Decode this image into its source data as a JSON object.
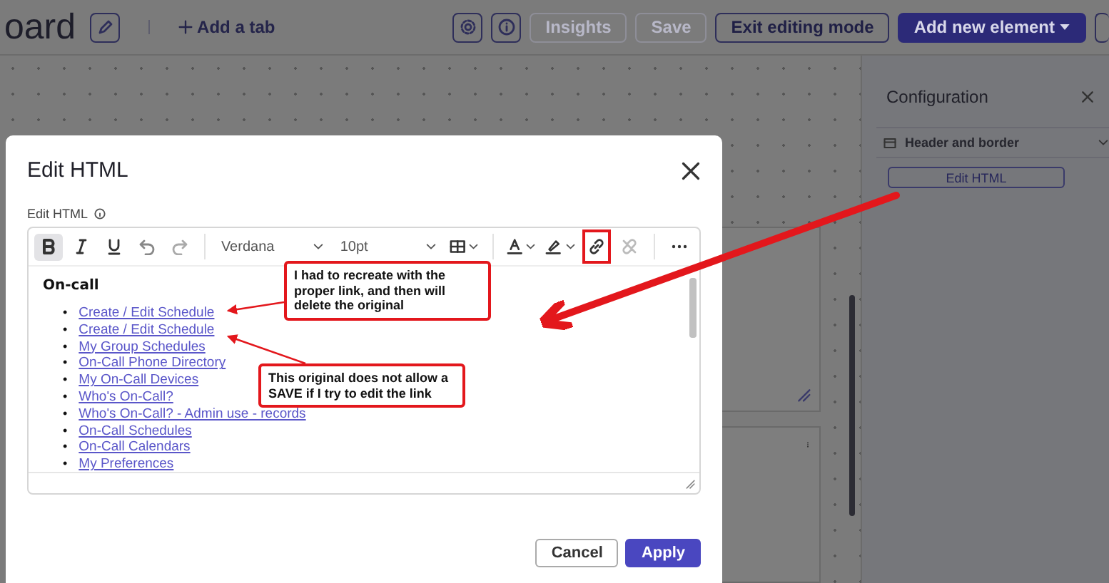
{
  "header": {
    "title": "oard",
    "add_tab": "Add a tab",
    "buttons": [
      {
        "kind": "outline",
        "label": "Insights",
        "disabled": true
      },
      {
        "kind": "outline",
        "label": "Save",
        "disabled": true
      },
      {
        "kind": "outline",
        "label": "Exit editing mode",
        "disabled": false
      },
      {
        "kind": "primary",
        "label": "Add new element",
        "disabled": false
      }
    ]
  },
  "configuration": {
    "title": "Configuration",
    "section": "Header and border",
    "button": "Edit HTML"
  },
  "dialog": {
    "title": "Edit HTML",
    "field_label": "Edit HTML",
    "toolbar": {
      "format_buttons": [
        {
          "kind": "bold",
          "active": true
        },
        {
          "kind": "italic",
          "active": false
        },
        {
          "kind": "underline",
          "active": false
        }
      ],
      "font": "Verdana",
      "size": "10pt"
    },
    "content": {
      "heading": "On-call",
      "bullet": "•",
      "links": [
        "Create / Edit Schedule",
        "Create / Edit Schedule",
        "My Group Schedules",
        "On-Call Phone Directory",
        "My On-Call Devices",
        "Who's On-Call?",
        "Who's On-Call? - Admin use - records",
        "On-Call Schedules",
        "On-Call Calendars",
        "My Preferences"
      ]
    },
    "buttons": [
      {
        "kind": "secondary",
        "label": "Cancel"
      },
      {
        "kind": "primary",
        "label": "Apply"
      }
    ]
  },
  "annotations": [
    "I had to recreate with the proper link, and then will delete the original",
    "This original does not allow a SAVE if I try to edit the link"
  ]
}
